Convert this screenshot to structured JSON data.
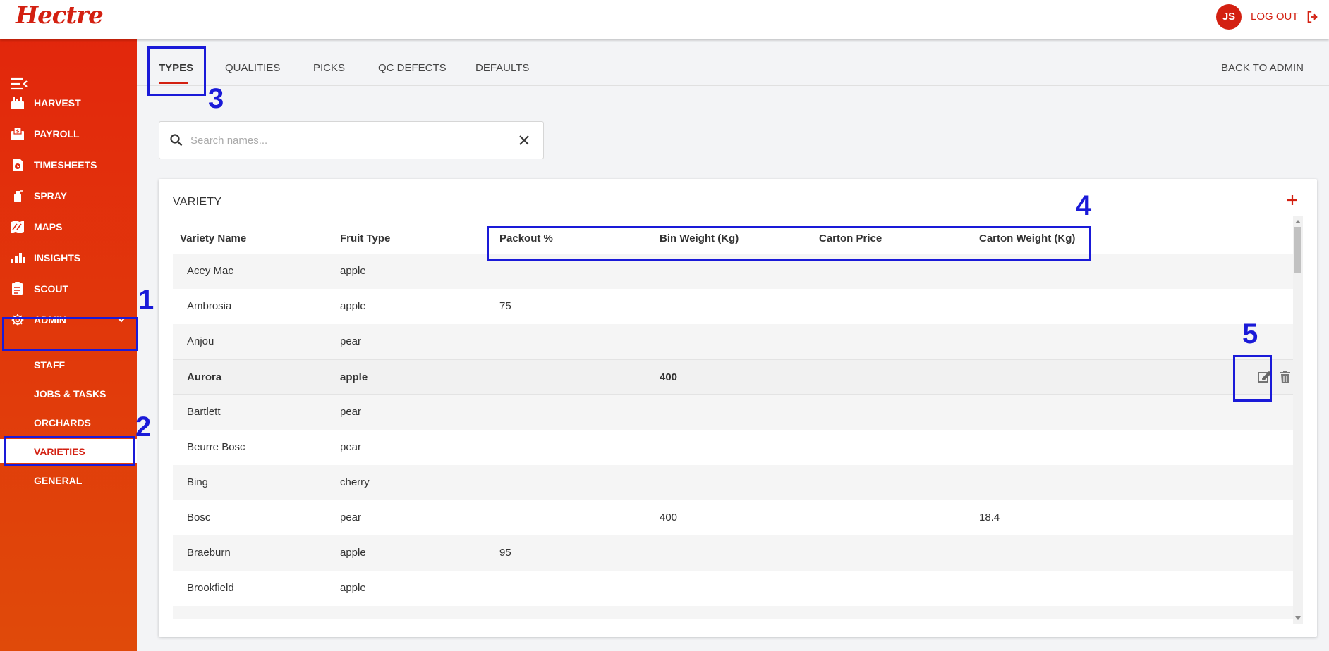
{
  "app": {
    "logo": "Hectre",
    "user_initials": "JS",
    "logout_label": "LOG OUT"
  },
  "sidebar": {
    "items": [
      {
        "label": "HARVEST",
        "icon": "harvest-icon"
      },
      {
        "label": "PAYROLL",
        "icon": "payroll-icon"
      },
      {
        "label": "TIMESHEETS",
        "icon": "timesheets-icon"
      },
      {
        "label": "SPRAY",
        "icon": "spray-icon"
      },
      {
        "label": "MAPS",
        "icon": "maps-icon"
      },
      {
        "label": "INSIGHTS",
        "icon": "insights-icon"
      },
      {
        "label": "SCOUT",
        "icon": "scout-icon"
      },
      {
        "label": "ADMIN",
        "icon": "gear-icon"
      }
    ],
    "admin_sub": [
      {
        "label": "STAFF"
      },
      {
        "label": "JOBS & TASKS"
      },
      {
        "label": "ORCHARDS"
      },
      {
        "label": "VARIETIES",
        "active": true
      },
      {
        "label": "GENERAL"
      }
    ]
  },
  "tabs": [
    {
      "label": "TYPES",
      "active": true
    },
    {
      "label": "QUALITIES"
    },
    {
      "label": "PICKS"
    },
    {
      "label": "QC DEFECTS"
    },
    {
      "label": "DEFAULTS"
    }
  ],
  "back_to_admin": "BACK TO ADMIN",
  "search": {
    "placeholder": "Search names...",
    "value": ""
  },
  "card": {
    "title": "VARIETY",
    "columns": [
      "Variety Name",
      "Fruit Type",
      "Packout %",
      "Bin Weight (Kg)",
      "Carton Price",
      "Carton Weight (Kg)"
    ],
    "rows": [
      [
        "Acey Mac",
        "apple",
        "",
        "",
        "",
        ""
      ],
      [
        "Ambrosia",
        "apple",
        "75",
        "",
        "",
        ""
      ],
      [
        "Anjou",
        "pear",
        "",
        "",
        "",
        ""
      ],
      [
        "Aurora",
        "apple",
        "",
        "400",
        "",
        ""
      ],
      [
        "Bartlett",
        "pear",
        "",
        "",
        "",
        ""
      ],
      [
        "Beurre Bosc",
        "pear",
        "",
        "",
        "",
        ""
      ],
      [
        "Bing",
        "cherry",
        "",
        "",
        "",
        ""
      ],
      [
        "Bosc",
        "pear",
        "",
        "400",
        "",
        "18.4"
      ],
      [
        "Braeburn",
        "apple",
        "95",
        "",
        "",
        ""
      ],
      [
        "Brookfield",
        "apple",
        "",
        "",
        "",
        ""
      ]
    ],
    "highlighted_row": "Aurora"
  },
  "annotations": [
    "1",
    "2",
    "3",
    "4",
    "5"
  ],
  "colors": {
    "brand": "#d32011",
    "annotation": "#1a1ad8"
  }
}
